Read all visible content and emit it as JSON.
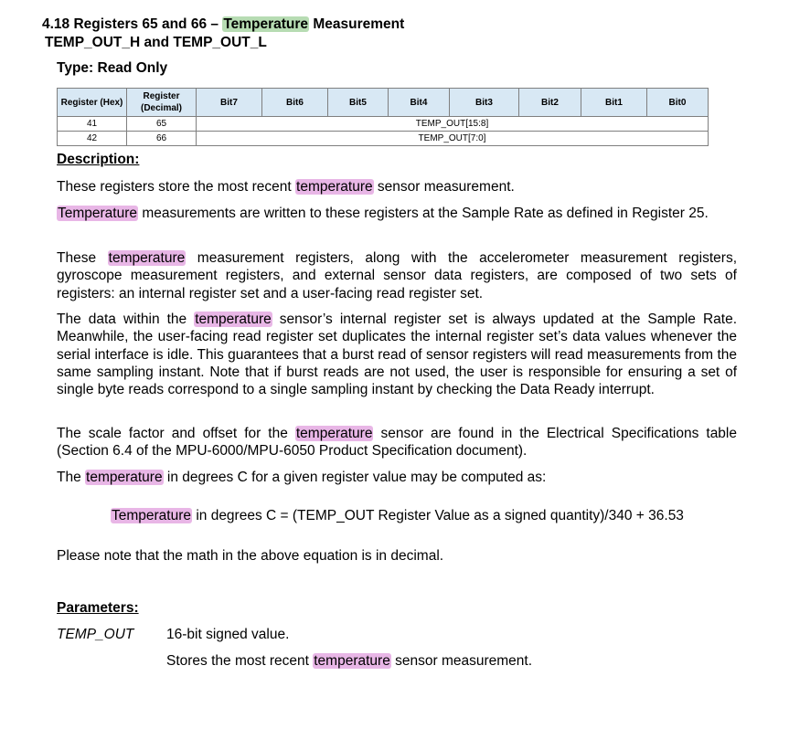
{
  "heading": {
    "line1_pre": "4.18   Registers 65 and 66 – ",
    "line1_highlight": "Temperature",
    "line1_post": " Measurement",
    "line2": "TEMP_OUT_H and TEMP_OUT_L"
  },
  "type_label": "Type: Read Only",
  "table": {
    "col_reg_hex": "Register (Hex)",
    "col_reg_dec": "Register (Decimal)",
    "bits": [
      "Bit7",
      "Bit6",
      "Bit5",
      "Bit4",
      "Bit3",
      "Bit2",
      "Bit1",
      "Bit0"
    ],
    "rows": [
      {
        "hex": "41",
        "dec": "65",
        "field": "TEMP_OUT[15:8]"
      },
      {
        "hex": "42",
        "dec": "66",
        "field": "TEMP_OUT[7:0]"
      }
    ]
  },
  "description": {
    "heading": "Description:",
    "p1_pre": "These registers store the most recent ",
    "p1_hl": "temperature",
    "p1_post": " sensor measurement.",
    "p2_hl": "Temperature",
    "p2_post": " measurements are written to these registers at the Sample Rate as defined in Register 25.",
    "p3_pre": "These ",
    "p3_hl": "temperature",
    "p3_post": " measurement registers, along with the accelerometer measurement registers, gyroscope measurement registers, and external sensor data registers, are composed of two sets of registers: an internal register set and a user-facing read register set.",
    "p4_pre": "The data within the ",
    "p4_hl": "temperature",
    "p4_post": " sensor’s internal register set is always updated at the Sample Rate. Meanwhile, the user-facing read register set duplicates the internal register set’s data values whenever the serial interface is idle. This guarantees that a burst read of sensor registers will read measurements from the same sampling instant. Note that if burst reads are not used, the user is responsible for ensuring a set of single byte reads correspond to a single sampling instant by checking the Data Ready interrupt.",
    "p5_pre": "The scale factor and offset for the ",
    "p5_hl": "temperature",
    "p5_post": " sensor are found in the Electrical Specifications table (Section 6.4 of the MPU-6000/MPU-6050 Product Specification document).",
    "p6_pre": "The ",
    "p6_hl": "temperature",
    "p6_post": " in degrees C for a given register value may be computed as:",
    "eq_hl": "Temperature",
    "eq_post": " in degrees C = (TEMP_OUT Register Value as a signed quantity)/340 + 36.53",
    "p7": "Please note that the math in the above equation is in decimal."
  },
  "parameters": {
    "heading": "Parameters:",
    "name": "TEMP_OUT",
    "line1": "16-bit signed value.",
    "line2_pre": "Stores the most recent ",
    "line2_hl": "temperature",
    "line2_post": " sensor measurement."
  },
  "colors": {
    "header_cell_bg": "#d8e8f4",
    "highlight_green": "#b7dcb3",
    "highlight_pink": "#e8b6e6"
  }
}
